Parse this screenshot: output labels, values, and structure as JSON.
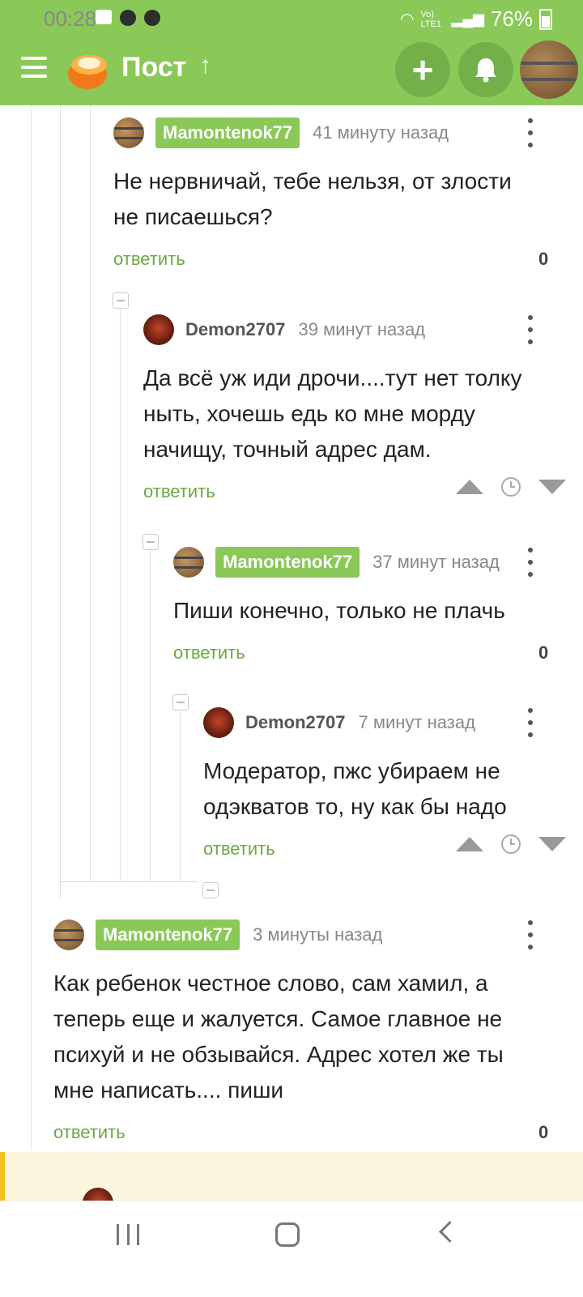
{
  "status_bar": {
    "time": "00:28",
    "network": "Vo) LTE1",
    "battery": "76%"
  },
  "app_bar": {
    "title": "Пост",
    "arrow": "↑",
    "add_label": "+"
  },
  "comments": [
    {
      "user": "Mamontenok77",
      "time": "41 минуту назад",
      "text_lines": [
        "Не нервничай, тебе нельзя, от злости",
        "не писаешься?"
      ],
      "reply_label": "ответить",
      "score": "0"
    },
    {
      "user": "Demon2707",
      "time": "39 минут назад",
      "text_lines": [
        "Да всё уж иди дрочи....тут нет толку",
        "ныть, хочешь едь ко мне морду",
        "начищу, точный адрес дам."
      ],
      "reply_label": "ответить"
    },
    {
      "user": "Mamontenok77",
      "time": "37 минут назад",
      "text_lines": [
        "Пиши конечно, только не плачь"
      ],
      "reply_label": "ответить",
      "score": "0"
    },
    {
      "user": "Demon2707",
      "time": "7 минут назад",
      "text_lines": [
        "Модератор, пжс убираем не",
        "одэкватов то, ну как бы надо"
      ],
      "reply_label": "ответить"
    },
    {
      "user": "Mamontenok77",
      "time": "3 минуты назад",
      "text_lines": [
        "Как ребенок честное слово, сам хамил, а",
        "теперь еще и жалуется. Самое главное не",
        "психуй и не обзывайся. Адрес хотел же ты",
        "мне написать.... пиши"
      ],
      "reply_label": "ответить",
      "score": "0"
    }
  ],
  "colors": {
    "brand_green": "#8ac858",
    "highlight_yellow": "#f2c01c"
  },
  "icons": [
    "menu-icon",
    "pikabu-logo",
    "arrow-up-icon",
    "plus-icon",
    "bell-icon",
    "more-icon",
    "upvote-icon",
    "clock-icon",
    "downvote-icon",
    "collapse-icon"
  ]
}
